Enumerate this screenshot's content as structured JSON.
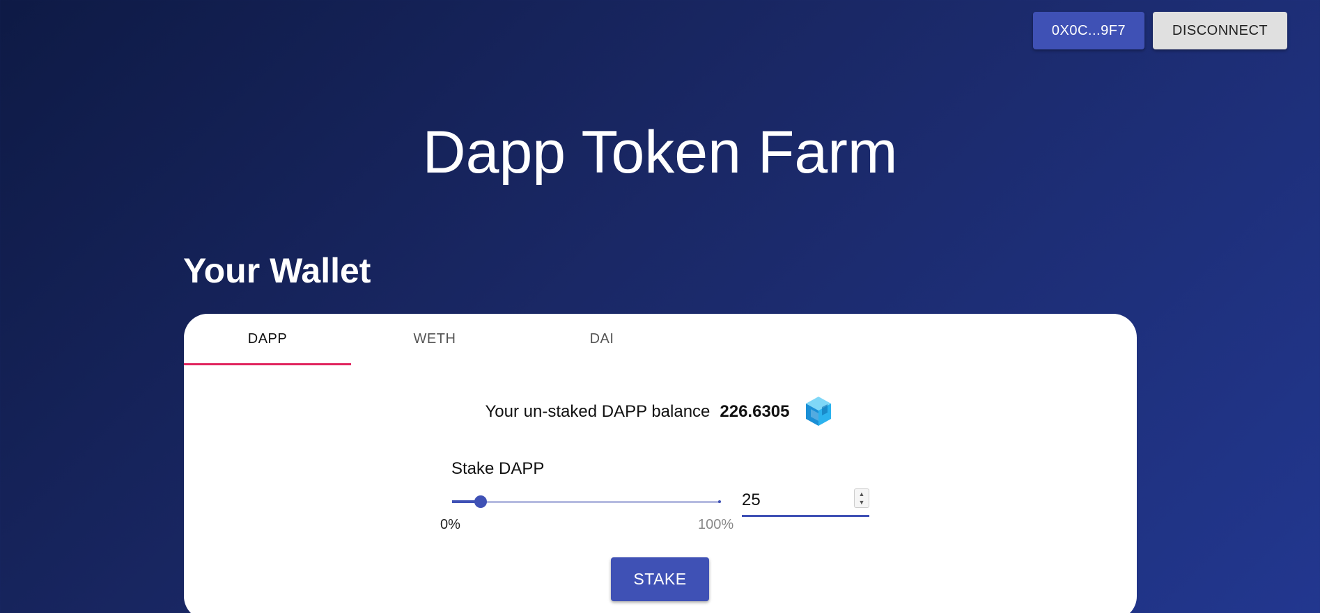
{
  "header": {
    "address_label": "0X0C...9F7",
    "disconnect_label": "DISCONNECT"
  },
  "page_title": "Dapp Token Farm",
  "wallet": {
    "section_title": "Your Wallet",
    "tabs": [
      {
        "label": "DAPP",
        "active": true
      },
      {
        "label": "WETH",
        "active": false
      },
      {
        "label": "DAI",
        "active": false
      }
    ],
    "balance_label": "Your un-staked DAPP balance",
    "balance_value": "226.6305",
    "token_icon": "dapp-token-icon",
    "stake": {
      "label": "Stake DAPP",
      "slider_percent": 10.7,
      "min_label": "0%",
      "max_label": "100%",
      "amount_value": "25",
      "button_label": "STAKE"
    }
  },
  "colors": {
    "primary": "#3f51b5",
    "tab_indicator": "#e0245e",
    "background_start": "#0e1a45",
    "background_end": "#22378f"
  }
}
